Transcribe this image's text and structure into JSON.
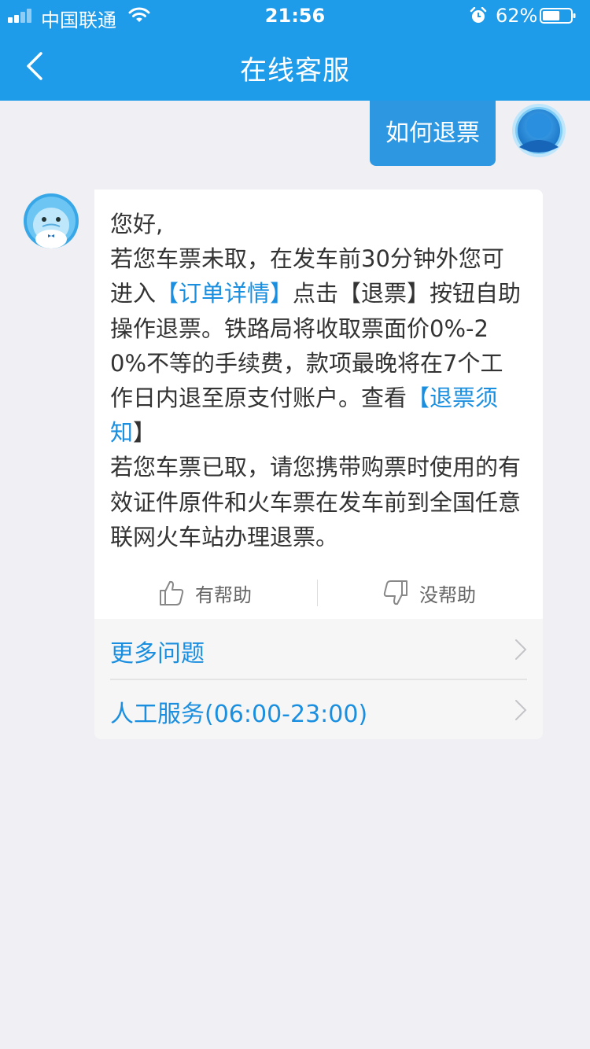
{
  "status_bar": {
    "carrier": "中国联通",
    "time": "21:56",
    "battery_pct": "62%",
    "battery_level": 0.62
  },
  "nav": {
    "title": "在线客服",
    "back_icon": "chevron-left-icon"
  },
  "chat": {
    "user_message": "如何退票",
    "bot_message": {
      "greeting": "您好,",
      "p1_a": "若您车票未取，在发车前30分钟外您可进入",
      "p1_link_order": "【订单详情】",
      "p1_b": "点击【退票】按钮自助操作退票。铁路局将收取票面价0%-20%不等的手续费，款项最晚将在7个工作日内退至原支付账户。查看",
      "p1_link_notice": "【退票须知",
      "p1_c": "】",
      "p2": "若您车票已取，请您携带购票时使用的有效证件原件和火车票在发车前到全国任意联网火车站办理退票。"
    },
    "feedback": {
      "helpful": "有帮助",
      "unhelpful": "没帮助"
    },
    "more_options": [
      {
        "label": "更多问题"
      },
      {
        "label": "人工服务(06:00-23:00)"
      }
    ]
  },
  "colors": {
    "brand": "#1e9be9",
    "user_bubble": "#2d97e2",
    "link": "#1a8fe0",
    "background": "#efeff4"
  }
}
